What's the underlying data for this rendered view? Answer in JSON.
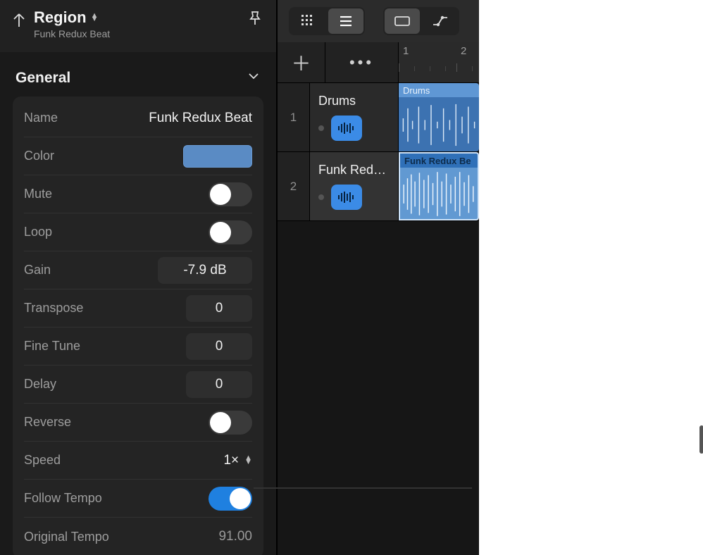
{
  "header": {
    "title": "Region",
    "subtitle": "Funk Redux Beat"
  },
  "section": {
    "title": "General"
  },
  "fields": {
    "name": {
      "label": "Name",
      "value": "Funk Redux Beat"
    },
    "color": {
      "label": "Color",
      "hex": "#5a8bc4"
    },
    "mute": {
      "label": "Mute"
    },
    "loop": {
      "label": "Loop"
    },
    "gain": {
      "label": "Gain",
      "value": "-7.9 dB"
    },
    "transpose": {
      "label": "Transpose",
      "value": "0"
    },
    "fine_tune": {
      "label": "Fine Tune",
      "value": "0"
    },
    "delay": {
      "label": "Delay",
      "value": "0"
    },
    "reverse": {
      "label": "Reverse"
    },
    "speed": {
      "label": "Speed",
      "value": "1×"
    },
    "follow_tempo": {
      "label": "Follow Tempo"
    },
    "original_tempo": {
      "label": "Original Tempo",
      "value": "91.00"
    }
  },
  "ruler": {
    "pos1": "1",
    "pos2": "2"
  },
  "tracks": [
    {
      "num": "1",
      "name": "Drums",
      "region_label": "Drums"
    },
    {
      "num": "2",
      "name": "Funk Red…",
      "region_label": "Funk Redux Be"
    }
  ]
}
